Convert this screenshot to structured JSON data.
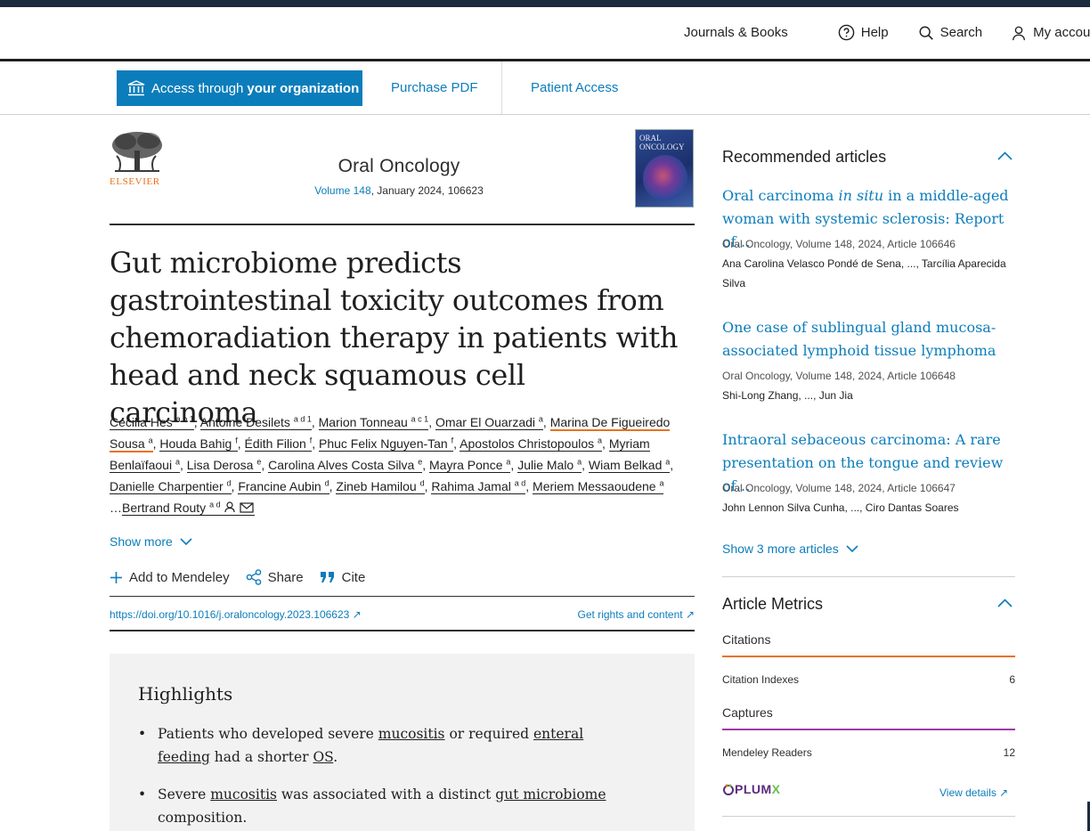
{
  "header": {
    "nav": [
      {
        "label": "Journals & Books",
        "icon": "none"
      },
      {
        "label": "Help",
        "icon": "help-circle-icon"
      },
      {
        "label": "Search",
        "icon": "search-icon"
      },
      {
        "label": "My accou",
        "icon": "person-icon"
      }
    ]
  },
  "access_bar": {
    "org_button_prefix": "Access through",
    "org_button_bold": "your organization",
    "purchase": "Purchase PDF",
    "patient": "Patient Access"
  },
  "journal": {
    "publisher": "ELSEVIER",
    "title": "Oral Oncology",
    "volume": "Volume 148",
    "issue_info": ", January 2024, 106623",
    "cover_text": "ORAL ONCOLOGY"
  },
  "article": {
    "title": "Gut microbiome predicts gastrointestinal toxicity outcomes from chemoradiation therapy in patients with head and neck squamous cell carcinoma",
    "authors": [
      {
        "name": "Cecilia Hes",
        "sup": "a b 1"
      },
      {
        "name": "Antoine Desilets",
        "sup": "a d 1"
      },
      {
        "name": "Marion Tonneau",
        "sup": "a c 1"
      },
      {
        "name": "Omar El Ouarzadi",
        "sup": "a"
      },
      {
        "name": "Marina De Figueiredo Sousa",
        "sup": "a"
      },
      {
        "name": "Houda Bahig",
        "sup": "f"
      },
      {
        "name": "Édith Filion",
        "sup": "f"
      },
      {
        "name": "Phuc Felix Nguyen-Tan",
        "sup": "f"
      },
      {
        "name": "Apostolos Christopoulos",
        "sup": "a"
      },
      {
        "name": "Myriam Benlaïfaoui",
        "sup": "a"
      },
      {
        "name": "Lisa Derosa",
        "sup": "e"
      },
      {
        "name": "Carolina Alves Costa Silva",
        "sup": "e"
      },
      {
        "name": "Mayra Ponce",
        "sup": "a"
      },
      {
        "name": "Julie Malo",
        "sup": "a"
      },
      {
        "name": "Wiam Belkad",
        "sup": "a"
      },
      {
        "name": "Danielle Charpentier",
        "sup": "d"
      },
      {
        "name": "Francine Aubin",
        "sup": "d"
      },
      {
        "name": "Zineb Hamilou",
        "sup": "d"
      },
      {
        "name": "Rahima Jamal",
        "sup": "a d"
      },
      {
        "name": "Meriem Messaoudene",
        "sup": "a"
      },
      {
        "name": "Bertrand Routy",
        "sup": "a d"
      }
    ],
    "show_more": "Show more",
    "actions": {
      "mendeley": "Add to Mendeley",
      "share": "Share",
      "cite": "Cite"
    },
    "doi": "https://doi.org/10.1016/j.oraloncology.2023.106623",
    "rights": "Get rights and content"
  },
  "highlights": {
    "heading": "Highlights",
    "item1": {
      "a": "Patients who developed severe ",
      "u1": "mucositis",
      "b": " or required ",
      "u2": "enteral feeding",
      "c": " had a shorter ",
      "u3": "OS",
      "d": "."
    },
    "item2": {
      "a": "Severe ",
      "u1": "mucositis",
      "b": " was associated with a distinct ",
      "u2": "gut microbiome",
      "c": " composition."
    }
  },
  "sidebar": {
    "recommended_heading": "Recommended articles",
    "recommended": [
      {
        "title_a": "Oral carcinoma ",
        "title_i": "in situ",
        "title_b": " in a middle-aged woman with systemic sclerosis: Report of…",
        "meta": "Oral Oncology, Volume 148, 2024, Article 106646",
        "authors": "Ana Carolina Velasco Pondé de Sena, ..., Tarcília Aparecida Silva"
      },
      {
        "title": "One case of sublingual gland mucosa-associated lymphoid tissue lymphoma",
        "meta": "Oral Oncology, Volume 148, 2024, Article 106648",
        "authors": "Shi-Long Zhang, ..., Jun Jia"
      },
      {
        "title": "Intraoral sebaceous carcinoma: A rare presentation on the tongue and review of…",
        "meta": "Oral Oncology, Volume 148, 2024, Article 106647",
        "authors": "John Lennon Silva Cunha, ..., Ciro Dantas Soares"
      }
    ],
    "show_more_articles": "Show 3 more articles",
    "metrics_heading": "Article Metrics",
    "citations_label": "Citations",
    "citation_indexes_label": "Citation Indexes",
    "citation_indexes_value": "6",
    "captures_label": "Captures",
    "mendeley_readers_label": "Mendeley Readers",
    "mendeley_readers_value": "12",
    "plumx_a": "PLUM",
    "plumx_b": "X",
    "view_details": "View details"
  },
  "colors": {
    "accent_blue": "#0c7dbb",
    "elsevier_orange": "#e9711c",
    "captures_purple": "#a03aa5",
    "top_strip": "#1c2b3e"
  }
}
